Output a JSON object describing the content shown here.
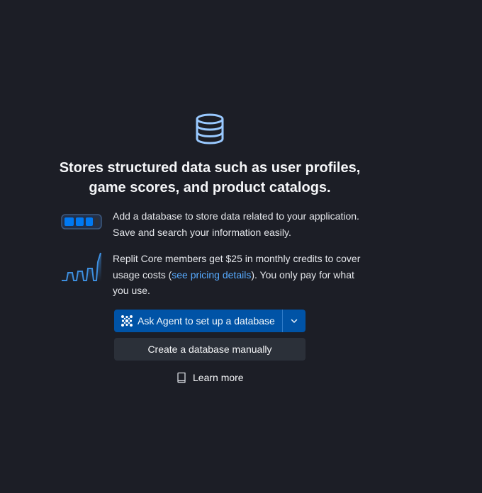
{
  "headline": "Stores structured data such as user profiles, game scores, and product catalogs.",
  "features": [
    {
      "icon": "storage-bars-icon",
      "text": "Add a database to store data related to your application. Save and search your information easily."
    },
    {
      "icon": "usage-chart-icon",
      "text_before": "Replit Core members get $25 in monthly credits to cover usage costs (",
      "link": "see pricing details",
      "text_after": "). You only pay for what you use."
    }
  ],
  "actions": {
    "primary_label": "Ask Agent to set up a database",
    "primary_icon": "agent-icon",
    "caret_icon": "chevron-down-icon",
    "secondary_label": "Create a database manually",
    "learn_more_label": "Learn more",
    "learn_more_icon": "book-icon"
  },
  "colors": {
    "background": "#1c1e26",
    "primary": "#0053a6",
    "secondary": "#2b3039",
    "accent": "#57abff",
    "icon_blue": "#99c9ff"
  }
}
